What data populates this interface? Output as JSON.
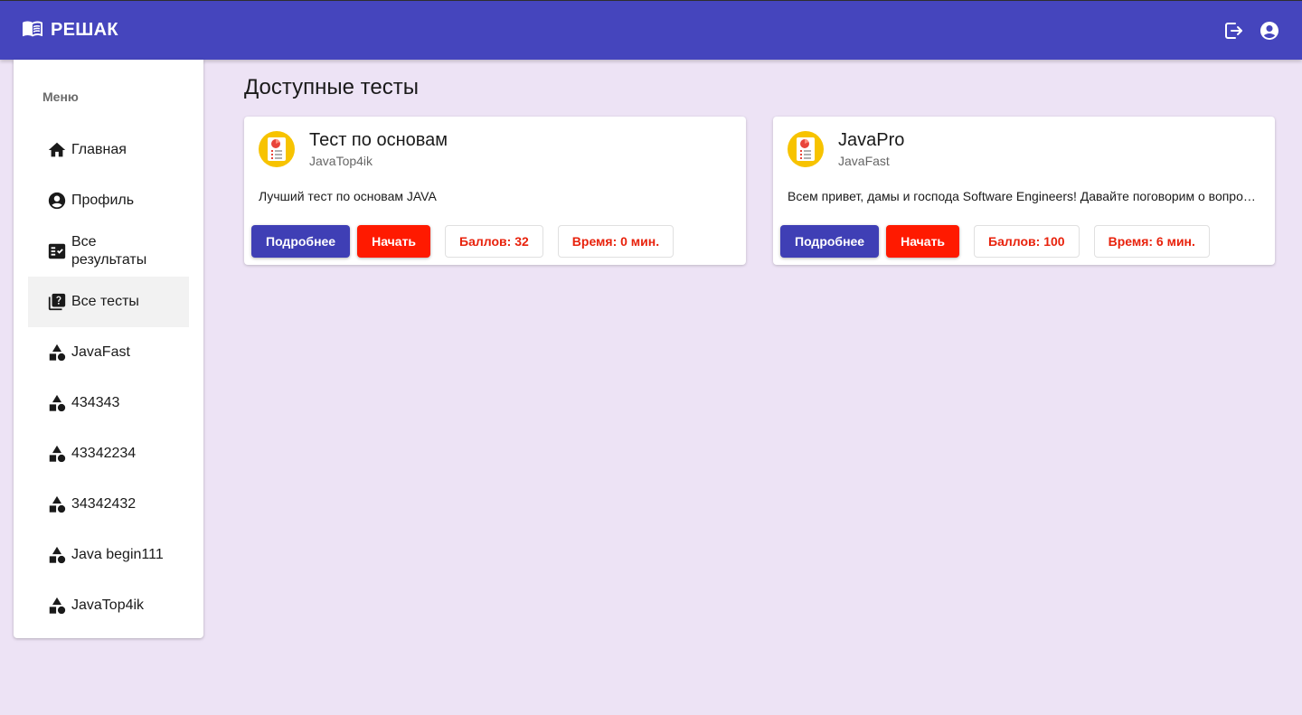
{
  "app": {
    "title": "РЕШАК"
  },
  "colors": {
    "header": "#4545bd",
    "primary_button": "#3f3fb5",
    "start_button": "#ff1a00",
    "chip_text": "#e8220c",
    "background": "#ede3f5"
  },
  "sidebar": {
    "header": "Меню",
    "items": [
      {
        "label": "Главная",
        "icon": "home-icon"
      },
      {
        "label": "Профиль",
        "icon": "account-circle-icon"
      },
      {
        "label": "Все результаты",
        "icon": "fact-check-icon"
      },
      {
        "label": "Все тесты",
        "icon": "quiz-icon",
        "active": true
      },
      {
        "label": "JavaFast",
        "icon": "category-icon"
      },
      {
        "label": "434343",
        "icon": "category-icon"
      },
      {
        "label": "43342234",
        "icon": "category-icon"
      },
      {
        "label": "34342432",
        "icon": "category-icon"
      },
      {
        "label": "Java begin111",
        "icon": "category-icon"
      },
      {
        "label": "JavaTop4ik",
        "icon": "category-icon"
      }
    ]
  },
  "main": {
    "title": "Доступные тесты",
    "cards": [
      {
        "title": "Тест по основам",
        "subtitle": "JavaTop4ik",
        "description": "Лучший тест по основам JAVA",
        "more_label": "Подробнее",
        "start_label": "Начать",
        "score": "Баллов: 32",
        "time": "Время: 0 мин."
      },
      {
        "title": "JavaPro",
        "subtitle": "JavaFast",
        "description": "Всем привет, дамы и господа Software Engineers! Давайте поговорим о вопро…",
        "more_label": "Подробнее",
        "start_label": "Начать",
        "score": "Баллов: 100",
        "time": "Время: 6 мин."
      }
    ]
  }
}
